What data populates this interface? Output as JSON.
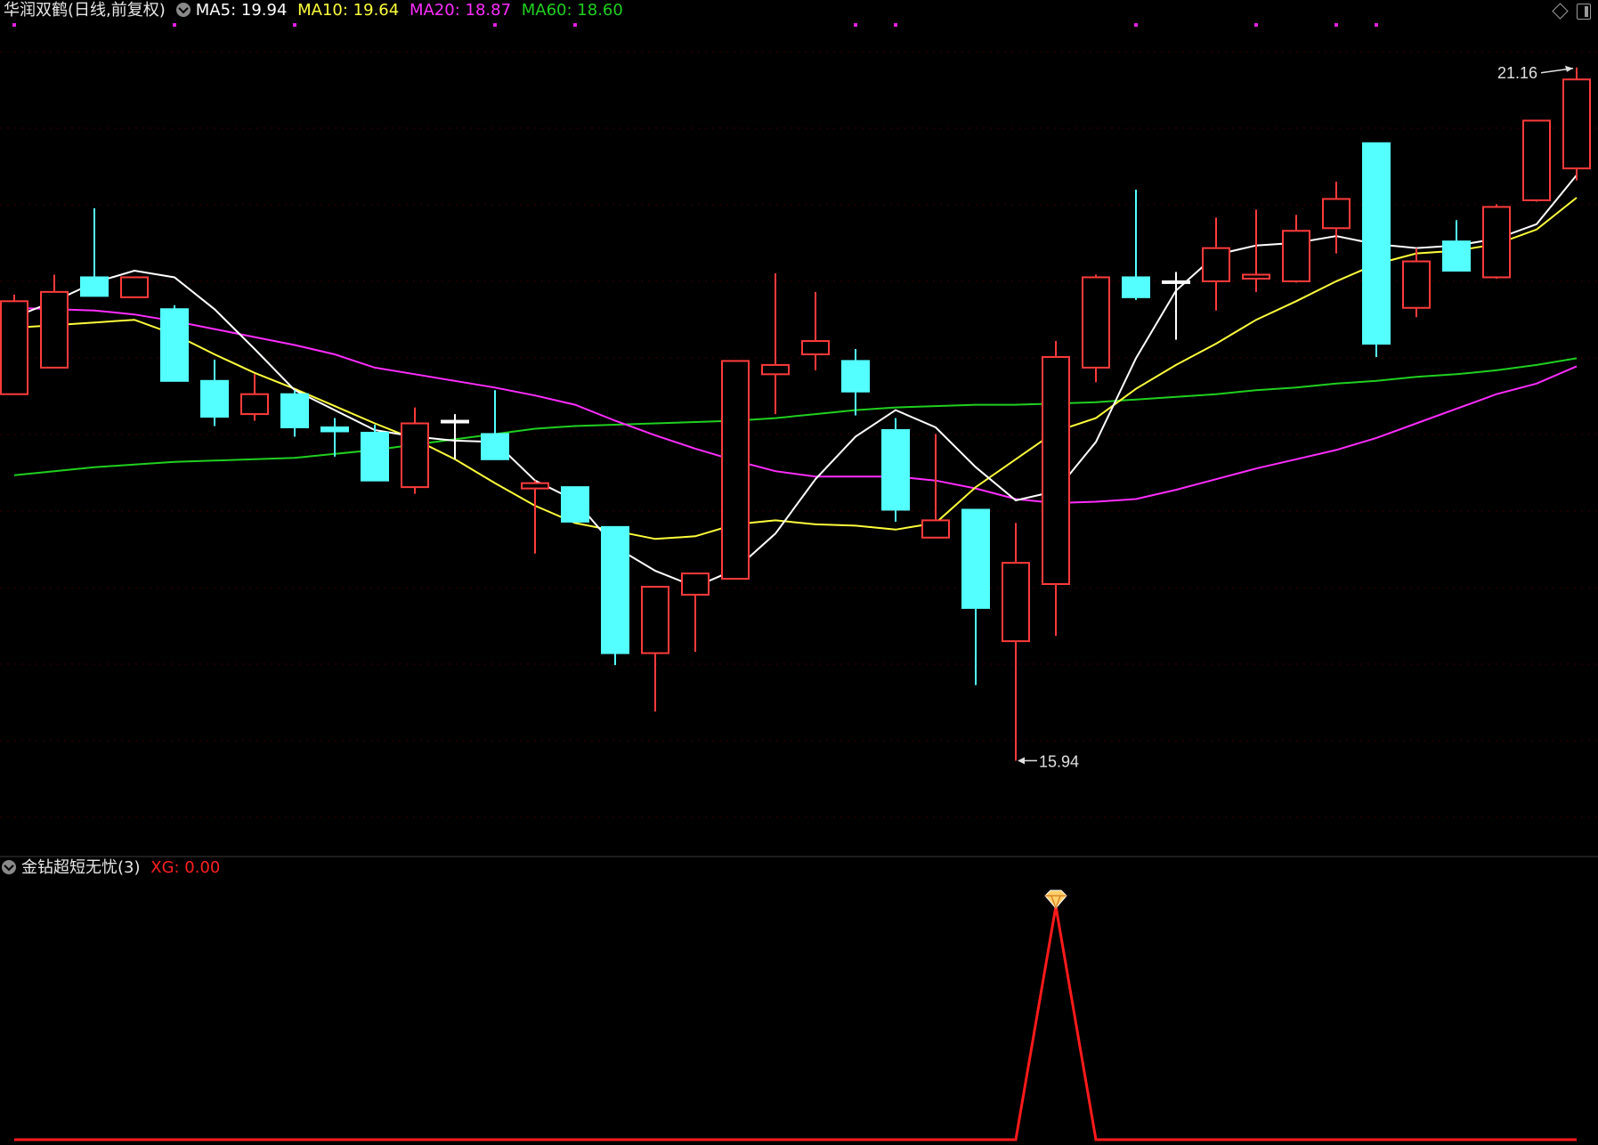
{
  "main_header": {
    "title": "华润双鹤(日线,前复权)",
    "ma5": "MA5: 19.94",
    "ma10": "MA10: 19.64",
    "ma20": "MA20: 18.87",
    "ma60": "MA60: 18.60"
  },
  "indicator_header": {
    "name": "金钻超短无忧(3)",
    "xg": "XG: 0.00"
  },
  "colors": {
    "background": "#000000",
    "up_candle": "#ff3b3b",
    "down_candle": "#54ffff",
    "cross_candle": "#ffffff",
    "ma5": "#ffffff",
    "ma10": "#ffff3b",
    "ma20": "#ff2dff",
    "ma60": "#1fd01f",
    "xg_line": "#ff1a1a",
    "grid": "#3a0000",
    "marker": "#e020e0"
  },
  "icons": [
    "collapse-icon",
    "diamond-icon",
    "panel-icon",
    "gem-signal-icon"
  ],
  "chart_data": [
    {
      "type": "candlestick",
      "title": "华润双鹤(日线,前复权)",
      "price_range": [
        15.5,
        21.4
      ],
      "candles": [
        {
          "o": 18.7,
          "h": 19.45,
          "l": 18.7,
          "c": 19.4
        },
        {
          "o": 18.9,
          "h": 19.6,
          "l": 18.9,
          "c": 19.47
        },
        {
          "o": 19.58,
          "h": 20.1,
          "l": 19.45,
          "c": 19.44
        },
        {
          "o": 19.43,
          "h": 19.48,
          "l": 19.5,
          "c": 19.58
        },
        {
          "o": 19.34,
          "h": 19.37,
          "l": 18.8,
          "c": 18.8
        },
        {
          "o": 18.8,
          "h": 18.96,
          "l": 18.46,
          "c": 18.53
        },
        {
          "o": 18.55,
          "h": 18.85,
          "l": 18.5,
          "c": 18.7
        },
        {
          "o": 18.7,
          "h": 18.73,
          "l": 18.38,
          "c": 18.45
        },
        {
          "o": 18.45,
          "h": 18.52,
          "l": 18.23,
          "c": 18.42
        },
        {
          "o": 18.41,
          "h": 18.47,
          "l": 18.05,
          "c": 18.05
        },
        {
          "o": 18.0,
          "h": 18.6,
          "l": 17.95,
          "c": 18.48
        },
        {
          "o": 18.5,
          "h": 18.55,
          "l": 18.21,
          "c": 18.5
        },
        {
          "o": 18.4,
          "h": 18.73,
          "l": 18.21,
          "c": 18.21
        },
        {
          "o": 17.99,
          "h": 18.05,
          "l": 17.5,
          "c": 18.03
        },
        {
          "o": 18.0,
          "h": 18.0,
          "l": 17.74,
          "c": 17.74
        },
        {
          "o": 17.7,
          "h": 17.7,
          "l": 16.66,
          "c": 16.75
        },
        {
          "o": 16.75,
          "h": 17.2,
          "l": 16.31,
          "c": 17.25
        },
        {
          "o": 17.19,
          "h": 17.31,
          "l": 16.76,
          "c": 17.35
        },
        {
          "o": 17.31,
          "h": 18.92,
          "l": 17.31,
          "c": 18.95
        },
        {
          "o": 18.85,
          "h": 19.61,
          "l": 18.55,
          "c": 18.92
        },
        {
          "o": 19.0,
          "h": 19.47,
          "l": 18.88,
          "c": 19.1
        },
        {
          "o": 18.95,
          "h": 19.04,
          "l": 18.54,
          "c": 18.72
        },
        {
          "o": 18.43,
          "h": 18.52,
          "l": 17.74,
          "c": 17.83
        },
        {
          "o": 17.62,
          "h": 18.4,
          "l": 17.62,
          "c": 17.75
        },
        {
          "o": 17.83,
          "h": 17.83,
          "l": 16.51,
          "c": 17.09
        },
        {
          "o": 16.84,
          "h": 17.73,
          "l": 15.94,
          "c": 17.43
        },
        {
          "o": 17.27,
          "h": 19.1,
          "l": 16.88,
          "c": 18.98
        },
        {
          "o": 18.9,
          "h": 19.6,
          "l": 18.79,
          "c": 19.58
        },
        {
          "o": 19.58,
          "h": 20.24,
          "l": 19.41,
          "c": 19.43
        },
        {
          "o": 19.55,
          "h": 19.62,
          "l": 19.11,
          "c": 19.55
        },
        {
          "o": 19.55,
          "h": 20.03,
          "l": 19.33,
          "c": 19.8
        },
        {
          "o": 19.57,
          "h": 20.09,
          "l": 19.47,
          "c": 19.6
        },
        {
          "o": 19.55,
          "h": 20.05,
          "l": 19.54,
          "c": 19.93
        },
        {
          "o": 19.95,
          "h": 20.3,
          "l": 19.76,
          "c": 20.17
        },
        {
          "o": 20.59,
          "h": 20.59,
          "l": 18.98,
          "c": 19.08
        },
        {
          "o": 19.35,
          "h": 19.8,
          "l": 19.28,
          "c": 19.7
        },
        {
          "o": 19.85,
          "h": 20.01,
          "l": 19.63,
          "c": 19.63
        },
        {
          "o": 19.58,
          "h": 20.13,
          "l": 19.57,
          "c": 20.11
        },
        {
          "o": 20.16,
          "h": 20.55,
          "l": 20.15,
          "c": 20.76
        },
        {
          "o": 20.4,
          "h": 21.16,
          "l": 20.31,
          "c": 21.07
        }
      ],
      "ma5": [
        19.28,
        19.4,
        19.54,
        19.63,
        19.58,
        19.34,
        19.04,
        18.73,
        18.58,
        18.43,
        18.38,
        18.35,
        18.34,
        18.05,
        17.9,
        17.55,
        17.37,
        17.25,
        17.38,
        17.65,
        18.06,
        18.38,
        18.58,
        18.45,
        18.15,
        17.9,
        17.97,
        18.34,
        18.97,
        19.48,
        19.75,
        19.82,
        19.84,
        19.89,
        19.83,
        19.8,
        19.82,
        19.87,
        19.98,
        20.35
      ],
      "ma10": [
        19.2,
        19.22,
        19.24,
        19.26,
        19.15,
        19.0,
        18.86,
        18.74,
        18.61,
        18.48,
        18.36,
        18.21,
        18.03,
        17.86,
        17.73,
        17.67,
        17.61,
        17.63,
        17.72,
        17.75,
        17.72,
        17.71,
        17.68,
        17.73,
        18.0,
        18.21,
        18.42,
        18.52,
        18.74,
        18.92,
        19.08,
        19.26,
        19.4,
        19.55,
        19.68,
        19.76,
        19.78,
        19.83,
        19.94,
        20.18
      ],
      "ma20": [
        19.35,
        19.34,
        19.33,
        19.3,
        19.25,
        19.19,
        19.13,
        19.07,
        19.0,
        18.9,
        18.85,
        18.8,
        18.75,
        18.69,
        18.62,
        18.5,
        18.39,
        18.29,
        18.2,
        18.12,
        18.08,
        18.08,
        18.08,
        18.05,
        17.99,
        17.91,
        17.88,
        17.89,
        17.91,
        17.98,
        18.06,
        18.14,
        18.21,
        18.28,
        18.37,
        18.48,
        18.59,
        18.7,
        18.78,
        18.91
      ],
      "ma60": [
        18.09,
        18.12,
        18.15,
        18.17,
        18.19,
        18.2,
        18.21,
        18.22,
        18.25,
        18.28,
        18.32,
        18.36,
        18.4,
        18.44,
        18.46,
        18.47,
        18.48,
        18.49,
        18.5,
        18.52,
        18.55,
        18.58,
        18.6,
        18.61,
        18.62,
        18.62,
        18.63,
        18.64,
        18.66,
        18.68,
        18.7,
        18.73,
        18.75,
        18.78,
        18.8,
        18.83,
        18.85,
        18.88,
        18.92,
        18.97
      ],
      "annotations": [
        {
          "label": "21.16",
          "candle_index": 39,
          "kind": "high"
        },
        {
          "label": "15.94",
          "candle_index": 25,
          "kind": "low"
        }
      ],
      "top_markers": [
        0,
        4,
        7,
        12,
        14,
        21,
        22,
        28,
        31,
        33,
        34
      ]
    },
    {
      "type": "line",
      "title": "金钻超短无忧(3)",
      "series": [
        {
          "name": "XG",
          "values": [
            0,
            0,
            0,
            0,
            0,
            0,
            0,
            0,
            0,
            0,
            0,
            0,
            0,
            0,
            0,
            0,
            0,
            0,
            0,
            0,
            0,
            0,
            0,
            0,
            0,
            0,
            1,
            0,
            0,
            0,
            0,
            0,
            0,
            0,
            0,
            0,
            0,
            0,
            0,
            0
          ]
        }
      ],
      "signal_index": 26,
      "ylim": [
        0,
        1
      ]
    }
  ]
}
